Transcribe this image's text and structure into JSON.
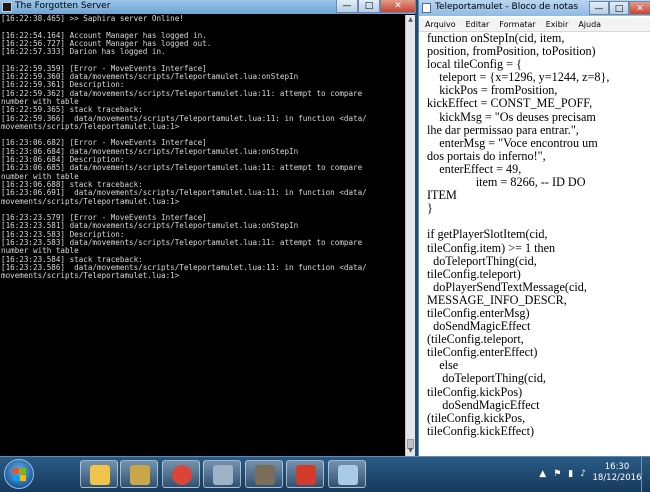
{
  "console": {
    "title": "The Forgotten Server",
    "lines": [
      "[16:22:38.465] >> Saphira server Online!",
      "",
      "[16:22:54.164] Account Manager has logged in.",
      "[16:22:56.727] Account Manager has logged out.",
      "[16:22:57.333] Darion has logged in.",
      "",
      "[16:22:59.359] [Error - MoveEvents Interface]",
      "[16:22:59.360] data/movements/scripts/Teleportamulet.lua:onStepIn",
      "[16:22:59.361] Description:",
      "[16:22:59.362] data/movements/scripts/Teleportamulet.lua:11: attempt to compare",
      "number with table",
      "[16:22:59.365] stack traceback:",
      "[16:22:59.366]  data/movements/scripts/Teleportamulet.lua:11: in function <data/",
      "movements/scripts/Teleportamulet.lua:1>",
      "",
      "[16:23:06.682] [Error - MoveEvents Interface]",
      "[16:23:06.684] data/movements/scripts/Teleportamulet.lua:onStepIn",
      "[16:23:06.684] Description:",
      "[16:23:06.685] data/movements/scripts/Teleportamulet.lua:11: attempt to compare",
      "number with table",
      "[16:23:06.688] stack traceback:",
      "[16:23:06.691]  data/movements/scripts/Teleportamulet.lua:11: in function <data/",
      "movements/scripts/Teleportamulet.lua:1>",
      "",
      "[16:23:23.579] [Error - MoveEvents Interface]",
      "[16:23:23.581] data/movements/scripts/Teleportamulet.lua:onStepIn",
      "[16:23:23.583] Description:",
      "[16:23:23.583] data/movements/scripts/Teleportamulet.lua:11: attempt to compare",
      "number with table",
      "[16:23:23.584] stack traceback:",
      "[16:23:23.586]  data/movements/scripts/Teleportamulet.lua:11: in function <data/",
      "movements/scripts/Teleportamulet.lua:1>"
    ],
    "buttons": {
      "minimize": "—",
      "maximize": "□",
      "close": "✕"
    }
  },
  "notepad": {
    "title": "Teleportamulet - Bloco de notas",
    "menu": [
      "Arquivo",
      "Editar",
      "Formatar",
      "Exibir",
      "Ajuda"
    ],
    "buttons": {
      "minimize": "—",
      "maximize": "□",
      "close": "✕"
    },
    "lines": [
      "function onStepIn(cid, item,",
      "position, fromPosition, toPosition)",
      "local tileConfig = {",
      "    teleport = {x=1296, y=1244, z=8},",
      "    kickPos = fromPosition,",
      "kickEffect = CONST_ME_POFF,",
      "    kickMsg = \"Os deuses precisam",
      "lhe dar permissao para entrar.\",",
      "    enterMsg = \"Voce encontrou um",
      "dos portais do inferno!\",",
      "    enterEffect = 49,",
      "                item = 8266, -- ID DO",
      "ITEM",
      "}",
      "",
      "if getPlayerSlotItem(cid,",
      "tileConfig.item) >= 1 then",
      "  doTeleportThing(cid,",
      "tileConfig.teleport)",
      "  doPlayerSendTextMessage(cid,",
      "MESSAGE_INFO_DESCR,",
      "tileConfig.enterMsg)",
      "  doSendMagicEffect",
      "(tileConfig.teleport,",
      "tileConfig.enterEffect)",
      "    else",
      "     doTeleportThing(cid,",
      "tileConfig.kickPos)",
      "     doSendMagicEffect",
      "(tileConfig.kickPos,",
      "tileConfig.kickEffect)"
    ]
  },
  "taskbar": {
    "time": "16:30",
    "date": "18/12/2016",
    "apps": [
      {
        "name": "windows-explorer",
        "color": "#f0c34a"
      },
      {
        "name": "lol-launcher",
        "color": "#c8a64a"
      },
      {
        "name": "chrome",
        "color": "#db4437"
      },
      {
        "name": "ot-client",
        "color": "#9fb3c8"
      },
      {
        "name": "server-tool",
        "color": "#7a6d5a"
      },
      {
        "name": "tibia",
        "color": "#d23a2a"
      },
      {
        "name": "notepad",
        "color": "#a9cbe8"
      }
    ],
    "tray_icons": [
      "flag-icon",
      "network-icon",
      "volume-icon",
      "arrow-icon"
    ],
    "colors": {
      "start_red": "#f25022",
      "start_green": "#7fba00",
      "start_blue": "#00a4ef",
      "start_yellow": "#ffb900"
    }
  }
}
